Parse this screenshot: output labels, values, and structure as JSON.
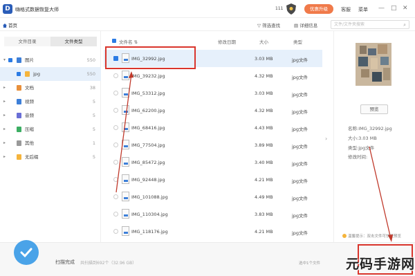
{
  "titlebar": {
    "logo": "D",
    "title": "嗨格式数据恢复大师",
    "counter": "111",
    "upgrade_label": "优惠升级",
    "service_label": "客服",
    "account_label": "菜单",
    "controls": [
      "—",
      "□",
      "✕"
    ]
  },
  "toolbar": {
    "home_label": "首页",
    "filter_label": "筛选查找",
    "detail_label": "详细信息",
    "search_placeholder": "文件/文件夹搜索"
  },
  "sidebar": {
    "tabs": [
      {
        "label": "文件目录",
        "active": false
      },
      {
        "label": "文件类型",
        "active": true
      }
    ],
    "items": [
      {
        "label": "图片",
        "count": "550",
        "color": "#3d7fd8",
        "arrow": "▾",
        "selected": false
      },
      {
        "label": "jpg",
        "count": "550",
        "color": "#f5b43c",
        "arrow": "",
        "selected": true
      },
      {
        "label": "文档",
        "count": "38",
        "color": "#e8903c",
        "arrow": "▸",
        "selected": false
      },
      {
        "label": "视频",
        "count": "5",
        "color": "#3d7fd8",
        "arrow": "▸",
        "selected": false
      },
      {
        "label": "音频",
        "count": "5",
        "color": "#6a6fd6",
        "arrow": "▸",
        "selected": false
      },
      {
        "label": "压缩",
        "count": "5",
        "color": "#3cae63",
        "arrow": "▸",
        "selected": false
      },
      {
        "label": "其他",
        "count": "1",
        "color": "#999999",
        "arrow": "▸",
        "selected": false
      },
      {
        "label": "无后缀",
        "count": "5",
        "color": "#f5b43c",
        "arrow": "▸",
        "selected": false
      }
    ]
  },
  "list": {
    "headers": {
      "name": "文件名 ⇅",
      "date": "修改日期",
      "size": "大小",
      "type": "类型"
    },
    "rows": [
      {
        "name": "IMG_32992.jpg",
        "size": "3.03 MB",
        "type": "jpg文件",
        "checked": true
      },
      {
        "name": "IMG_39232.jpg",
        "size": "4.32 MB",
        "type": "jpg文件",
        "checked": false
      },
      {
        "name": "IMG_53312.jpg",
        "size": "3.03 MB",
        "type": "jpg文件",
        "checked": false
      },
      {
        "name": "IMG_62200.jpg",
        "size": "4.32 MB",
        "type": "jpg文件",
        "checked": false
      },
      {
        "name": "IMG_68416.jpg",
        "size": "4.43 MB",
        "type": "jpg文件",
        "checked": false
      },
      {
        "name": "IMG_77504.jpg",
        "size": "3.89 MB",
        "type": "jpg文件",
        "checked": false
      },
      {
        "name": "IMG_85472.jpg",
        "size": "3.40 MB",
        "type": "jpg文件",
        "checked": false
      },
      {
        "name": "IMG_92448.jpg",
        "size": "4.21 MB",
        "type": "jpg文件",
        "checked": false
      },
      {
        "name": "IMG_101088.jpg",
        "size": "4.49 MB",
        "type": "jpg文件",
        "checked": false
      },
      {
        "name": "IMG_110304.jpg",
        "size": "3.83 MB",
        "type": "jpg文件",
        "checked": false
      },
      {
        "name": "IMG_118176.jpg",
        "size": "4.21 MB",
        "type": "jpg文件",
        "checked": false
      }
    ]
  },
  "details": {
    "preview_label": "预览",
    "name": "名称:IMG_32992.jpg",
    "size": "大小:3.03 MB",
    "type": "类型:jpg文件",
    "modified": "修改时间:",
    "tip": "温馨提示：双击文件可快速预览"
  },
  "footer": {
    "status": "扫描完成",
    "summary": "共扫描到692个（32.96 GB）",
    "selected": "选中1个文件"
  },
  "watermark": "元码手游网"
}
